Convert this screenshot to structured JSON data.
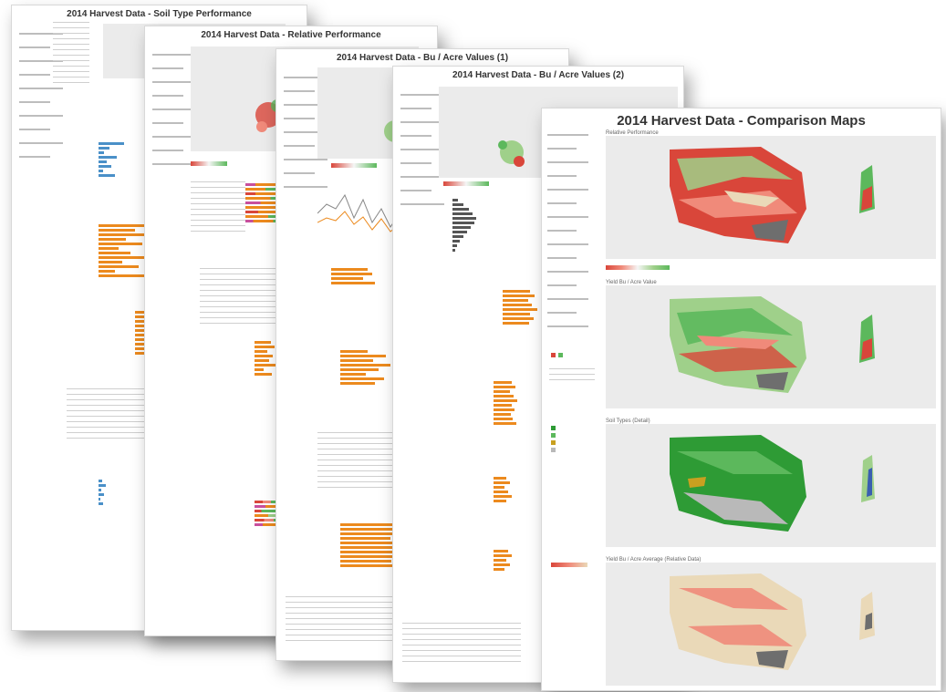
{
  "sheets": [
    {
      "title": "2014 Harvest Data - Soil Type Performance"
    },
    {
      "title": "2014 Harvest Data - Relative Performance"
    },
    {
      "title": "2014 Harvest Data - Bu / Acre Values (1)"
    },
    {
      "title": "2014 Harvest Data - Bu / Acre Values (2)"
    },
    {
      "title": "2014 Harvest Data - Comparison Maps",
      "map_panels": [
        {
          "label": "Relative Performance"
        },
        {
          "label": "Yield Bu / Acre Value"
        },
        {
          "label": "Soil Types (Detail)"
        },
        {
          "label": "Yield Bu / Acre Average (Relative Data)"
        }
      ]
    }
  ],
  "colors": {
    "red": "#d9463a",
    "pink": "#f08a7a",
    "tan": "#ead9b8",
    "green": "#5cb85c",
    "dark_green": "#2e9b35",
    "light_green": "#9fd08a",
    "grey": "#6e6e6e",
    "orange": "#ec8a1e",
    "panel_bg": "#ebebeb"
  }
}
